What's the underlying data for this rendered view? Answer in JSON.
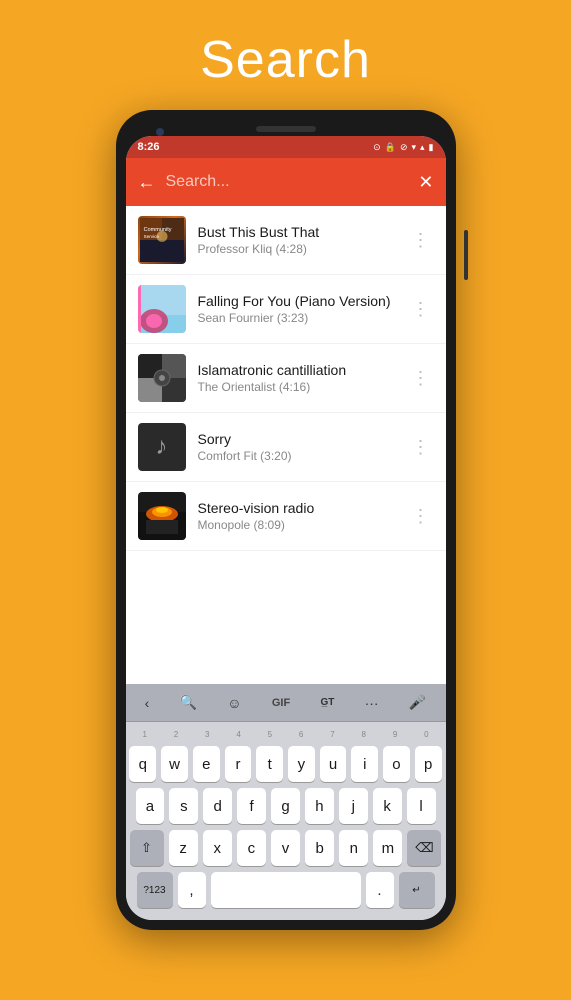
{
  "page": {
    "title": "Search",
    "background_color": "#F5A623"
  },
  "status_bar": {
    "time": "8:26",
    "wifi": "▼",
    "signal": "▲",
    "battery": "▮"
  },
  "search_bar": {
    "placeholder": "Search...",
    "back_label": "←",
    "clear_label": "✕"
  },
  "songs": [
    {
      "title": "Bust This Bust That",
      "artist": "Professor Kliq",
      "duration": "(4:28)",
      "art_type": "community"
    },
    {
      "title": "Falling For You (Piano Version)",
      "artist": "Sean Fournier",
      "duration": "(3:23)",
      "art_type": "flower"
    },
    {
      "title": "Islamatronic cantilliation",
      "artist": "The Orientalist",
      "duration": "(4:16)",
      "art_type": "grid"
    },
    {
      "title": "Sorry",
      "artist": "Comfort Fit",
      "duration": "(3:20)",
      "art_type": "note"
    },
    {
      "title": "Stereo-vision radio",
      "artist": "Monopole",
      "duration": "(8:09)",
      "art_type": "fire"
    }
  ],
  "keyboard": {
    "toolbar": {
      "back_label": "‹",
      "search_label": "🔍",
      "emoji_label": "☺",
      "gif_label": "GIF",
      "translate_label": "G̲T",
      "more_label": "···",
      "mic_label": "🎤"
    },
    "rows": [
      [
        "q",
        "w",
        "e",
        "r",
        "t",
        "y",
        "u",
        "i",
        "o",
        "p"
      ],
      [
        "a",
        "s",
        "d",
        "f",
        "g",
        "h",
        "j",
        "k",
        "l"
      ],
      [
        "z",
        "x",
        "c",
        "v",
        "b",
        "n",
        "m"
      ],
      [
        " "
      ]
    ],
    "nums": [
      "1",
      "2",
      "3",
      "4",
      "5",
      "6",
      "7",
      "8",
      "9",
      "0"
    ]
  }
}
